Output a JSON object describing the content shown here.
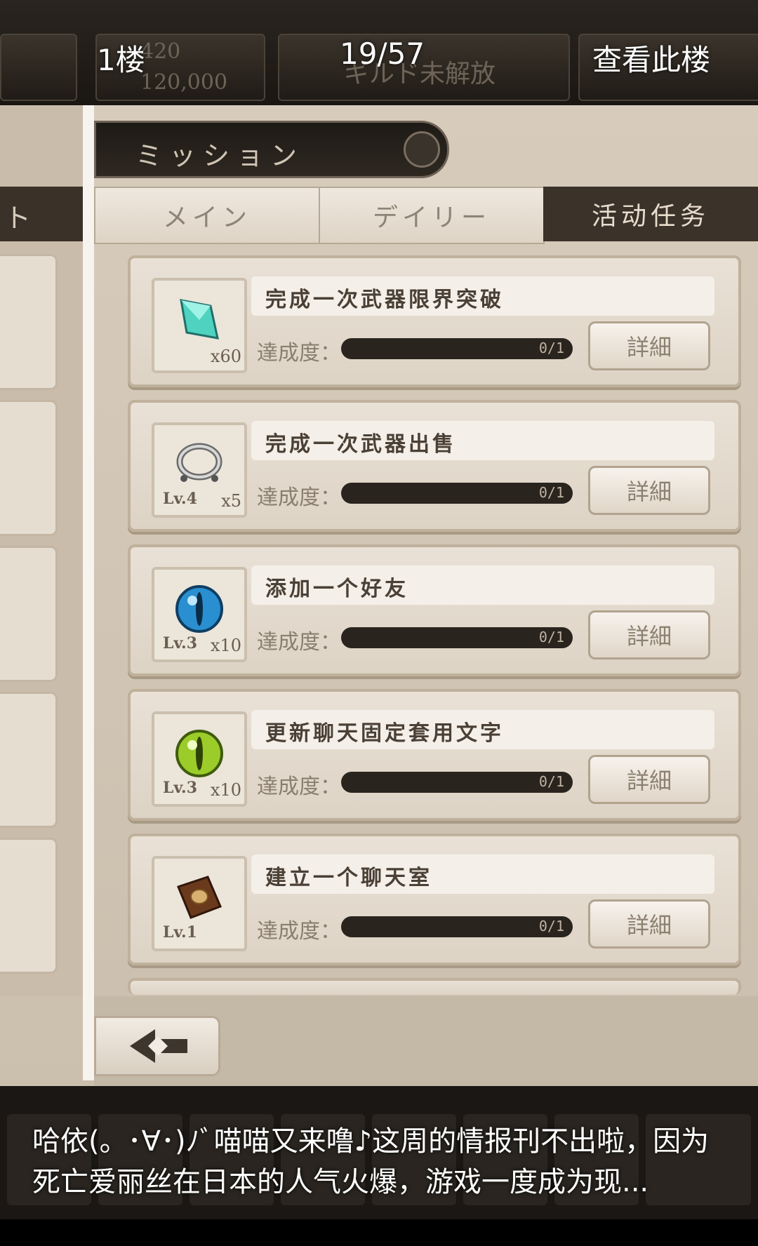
{
  "viewer": {
    "floor": "1楼",
    "counter": "19/57",
    "view_floor": "查看此楼",
    "caption": "哈依(。･∀･)ﾉﾞ喵喵又来噜♪这周的情报刊不出啦，因为死亡爱丽丝在日本的人气火爆，游戏一度成为现..."
  },
  "hud": {
    "count_small": "420",
    "count_large": "120,000",
    "guild_status": "ギルド未解放"
  },
  "screen_title": "ミッション",
  "left_tab_fragment": "ト",
  "tabs": [
    {
      "label": "メイン"
    },
    {
      "label": "デイリー"
    },
    {
      "label": "活动任务",
      "active": true
    }
  ],
  "missions": [
    {
      "title": "完成一次武器限界突破",
      "progress_label": "達成度：",
      "progress_text": "0/1",
      "progress_fraction": 0,
      "level": "",
      "qty": "x60",
      "icon": "crystal-icon",
      "button": "詳細"
    },
    {
      "title": "完成一次武器出售",
      "progress_label": "達成度：",
      "progress_text": "0/1",
      "progress_fraction": 0,
      "level": "Lv.4",
      "qty": "x5",
      "icon": "ring-icon",
      "button": "詳細"
    },
    {
      "title": "添加一个好友",
      "progress_label": "達成度：",
      "progress_text": "0/1",
      "progress_fraction": 0,
      "level": "Lv.3",
      "qty": "x10",
      "icon": "blue-eye-icon",
      "button": "詳細"
    },
    {
      "title": "更新聊天固定套用文字",
      "progress_label": "達成度：",
      "progress_text": "0/1",
      "progress_fraction": 0,
      "level": "Lv.3",
      "qty": "x10",
      "icon": "green-eye-icon",
      "button": "詳細"
    },
    {
      "title": "建立一个聊天室",
      "progress_label": "達成度：",
      "progress_text": "0/1",
      "progress_fraction": 0,
      "level": "Lv.1",
      "qty": "",
      "icon": "book-icon",
      "button": "詳細"
    }
  ],
  "colors": {
    "progress_track": "#2a241e",
    "active_tab": "#3b322a",
    "parchment": "#d7cbbc"
  }
}
